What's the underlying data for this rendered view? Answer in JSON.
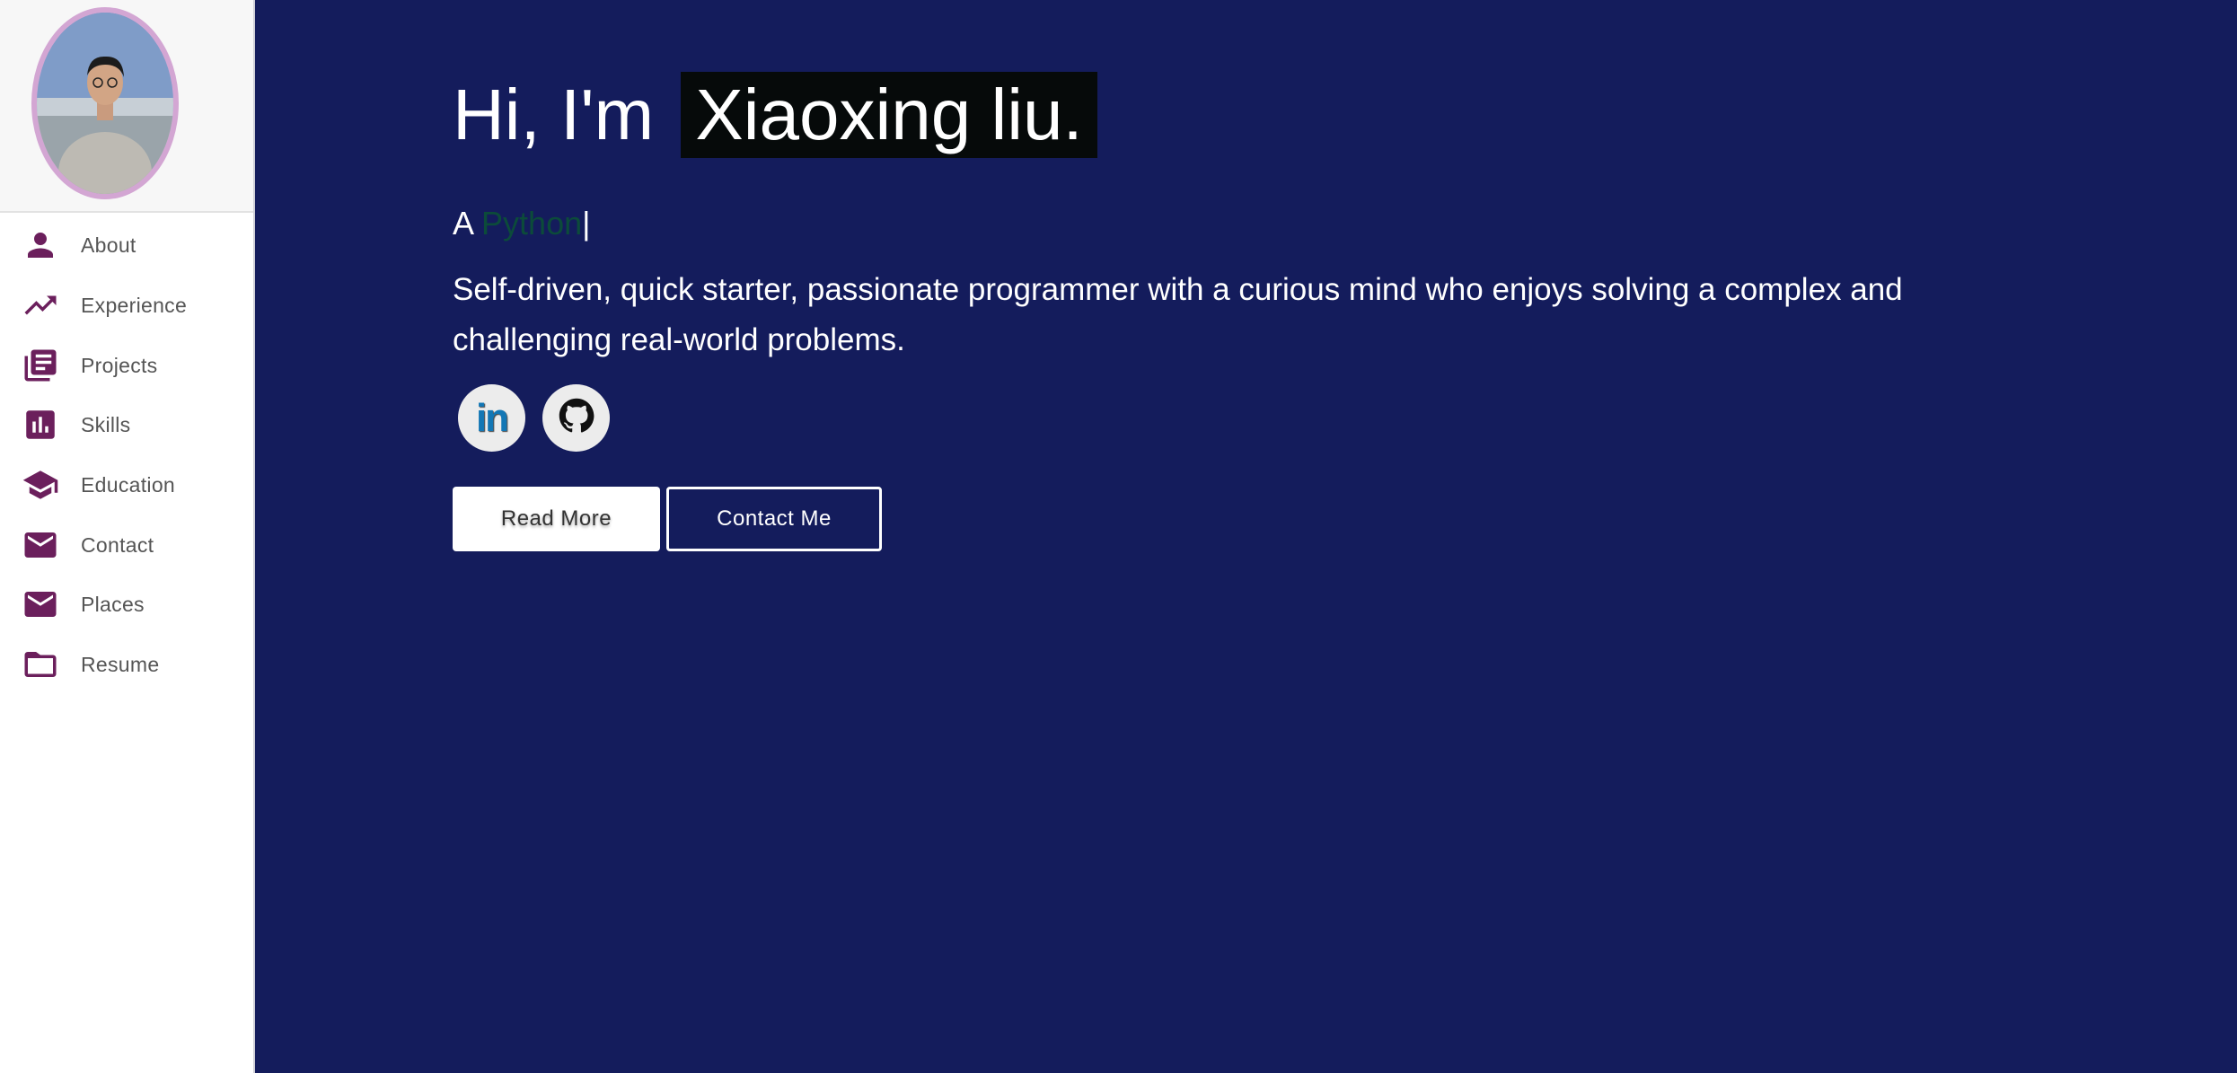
{
  "profile": {
    "avatar_alt": "Profile photo"
  },
  "sidebar": {
    "items": [
      {
        "label": "About",
        "icon": "person-icon"
      },
      {
        "label": "Experience",
        "icon": "trending-up-icon"
      },
      {
        "label": "Projects",
        "icon": "library-books-icon"
      },
      {
        "label": "Skills",
        "icon": "bar-chart-icon"
      },
      {
        "label": "Education",
        "icon": "school-icon"
      },
      {
        "label": "Contact",
        "icon": "mail-icon"
      },
      {
        "label": "Places",
        "icon": "mail-icon"
      },
      {
        "label": "Resume",
        "icon": "folder-icon"
      }
    ]
  },
  "hero": {
    "greeting": "Hi, I'm",
    "name": "Xiaoxing liu.",
    "role_prefix": "A",
    "role_word": "Python",
    "cursor": "|",
    "description": "Self-driven, quick starter, passionate programmer with a curious mind who enjoys solving a complex and challenging real-world problems.",
    "social": {
      "linkedin_label": "in",
      "github_label": "GitHub"
    },
    "buttons": {
      "read_more": "Read More",
      "contact_me": "Contact Me"
    }
  },
  "colors": {
    "background": "#141c5c",
    "sidebar_icon": "#6b1f5c",
    "role_word": "#0c4b3a",
    "avatar_border": "#d3a6d3"
  }
}
